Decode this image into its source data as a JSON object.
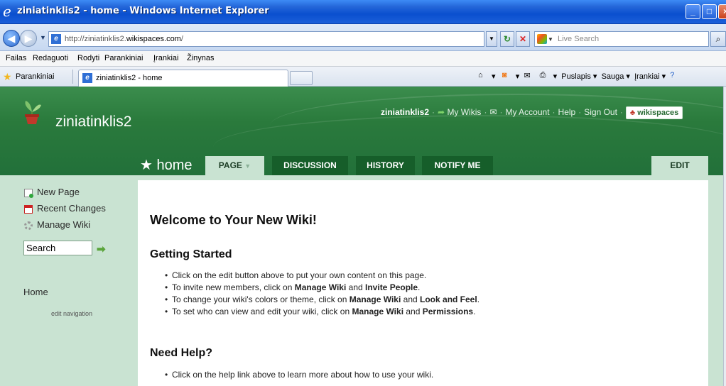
{
  "window": {
    "title": "ziniatinklis2 - home - Windows Internet Explorer"
  },
  "address": {
    "url_prefix": "http://ziniatinklis2.",
    "url_domain": "wikispaces.com",
    "url_suffix": "/",
    "search_placeholder": "Live Search"
  },
  "menu": [
    "Failas",
    "Redaguoti",
    "Rodyti",
    "Parankiniai",
    "Įrankiai",
    "Žinynas"
  ],
  "favorites": {
    "label": "Parankiniai",
    "tab_label": "ziniatinklis2 - home"
  },
  "toolbar_right": {
    "page": "Puslapis",
    "safety": "Sauga",
    "tools": "Įrankiai"
  },
  "wiki": {
    "site_name": "ziniatinklis2",
    "username": "ziniatinklis2",
    "links": [
      "My Wikis",
      "My Account",
      "Help",
      "Sign Out"
    ],
    "badge": "wikispaces",
    "page_title": "home",
    "tabs": {
      "page": "PAGE",
      "discussion": "DISCUSSION",
      "history": "HISTORY",
      "notify": "NOTIFY ME",
      "edit": "EDIT"
    },
    "sidebar": {
      "new_page": "New Page",
      "recent_changes": "Recent Changes",
      "manage_wiki": "Manage Wiki",
      "search_value": "Search",
      "home": "Home",
      "edit_navigation": "edit navigation"
    },
    "content": {
      "heading": "Welcome to Your New Wiki!",
      "getting_started": "Getting Started",
      "gs_items": [
        [
          "Click on the edit button above to put your own content on this page."
        ],
        [
          "To invite new members, click on ",
          "Manage Wiki",
          " and ",
          "Invite People",
          "."
        ],
        [
          "To change your wiki's colors or theme, click on ",
          "Manage Wiki",
          " and ",
          "Look and Feel",
          "."
        ],
        [
          "To set who can view and edit your wiki, click on ",
          "Manage Wiki",
          " and ",
          "Permissions",
          "."
        ]
      ],
      "need_help": "Need Help?",
      "help_items": [
        [
          "Click on the help link above to learn more about how to use your wiki."
        ]
      ]
    }
  }
}
